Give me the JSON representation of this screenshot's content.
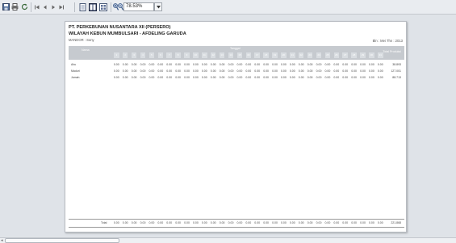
{
  "toolbar": {
    "zoom_value": "78.53%",
    "icons": [
      "save-icon",
      "print-icon",
      "refresh-icon",
      "first-page-icon",
      "prev-page-icon",
      "next-page-icon",
      "last-page-icon",
      "single-page-icon",
      "two-page-icon",
      "multi-page-icon",
      "zoom-in-icon",
      "zoom-out-icon"
    ]
  },
  "report": {
    "title1": "PT. PERKEBUNAN NUSANTARA XII (PERSERO)",
    "title2": "WILAYAH KEBUN MUMBULSARI - AFDELING GARUDA",
    "mandor": "MANDOR : Sony",
    "period": "Bln : Mei  Thn : 2013",
    "header_name": "Nama",
    "header_tanggal": "Tanggal",
    "header_total": "Total Produksi",
    "day_labels": [
      "1",
      "2",
      "3",
      "4",
      "5",
      "6",
      "7",
      "8",
      "9",
      "10",
      "11",
      "12",
      "13",
      "14",
      "15",
      "16",
      "17",
      "18",
      "19",
      "20",
      "21",
      "22",
      "23",
      "24",
      "25",
      "26",
      "27",
      "28",
      "29",
      "30",
      "31"
    ],
    "rows": [
      {
        "name": "Ahu",
        "values": [
          "0.00",
          "0.00",
          "0.00",
          "0.00",
          "0.00",
          "0.00",
          "0.00",
          "0.00",
          "0.00",
          "0.00",
          "0.00",
          "0.00",
          "0.00",
          "0.00",
          "0.00",
          "0.00",
          "0.00",
          "0.00",
          "0.00",
          "0.00",
          "0.00",
          "0.00",
          "0.00",
          "0.00",
          "0.00",
          "0.00",
          "0.00",
          "0.00",
          "0.00",
          "0.00",
          "0.00"
        ],
        "total": "38.893"
      },
      {
        "name": "Maduri",
        "values": [
          "0.00",
          "0.00",
          "0.00",
          "0.00",
          "0.00",
          "0.00",
          "0.00",
          "0.00",
          "0.00",
          "0.00",
          "0.00",
          "0.00",
          "0.00",
          "0.00",
          "0.00",
          "0.00",
          "0.00",
          "0.00",
          "0.00",
          "0.00",
          "0.00",
          "0.00",
          "0.00",
          "0.00",
          "0.00",
          "0.00",
          "0.00",
          "0.00",
          "0.00",
          "0.00",
          "0.00"
        ],
        "total": "127.001"
      },
      {
        "name": "Jamah",
        "values": [
          "0.00",
          "0.00",
          "0.00",
          "0.00",
          "0.00",
          "0.00",
          "0.00",
          "0.00",
          "0.00",
          "0.00",
          "0.00",
          "0.00",
          "0.00",
          "0.00",
          "0.00",
          "0.00",
          "0.00",
          "0.00",
          "0.00",
          "0.00",
          "0.00",
          "0.00",
          "0.00",
          "0.00",
          "0.00",
          "0.00",
          "0.00",
          "0.00",
          "0.00",
          "0.00",
          "0.00"
        ],
        "total": "88.713"
      }
    ],
    "footer_label": "Total",
    "footer_values": [
      "0.00",
      "0.00",
      "0.00",
      "0.00",
      "0.00",
      "0.00",
      "0.00",
      "0.00",
      "0.00",
      "0.00",
      "0.00",
      "0.00",
      "0.00",
      "0.00",
      "0.00",
      "0.00",
      "0.00",
      "0.00",
      "0.00",
      "0.00",
      "0.00",
      "0.00",
      "0.00",
      "0.00",
      "0.00",
      "0.00",
      "0.00",
      "0.00",
      "0.00",
      "0.00",
      "0.00"
    ],
    "footer_total": "221.868"
  }
}
